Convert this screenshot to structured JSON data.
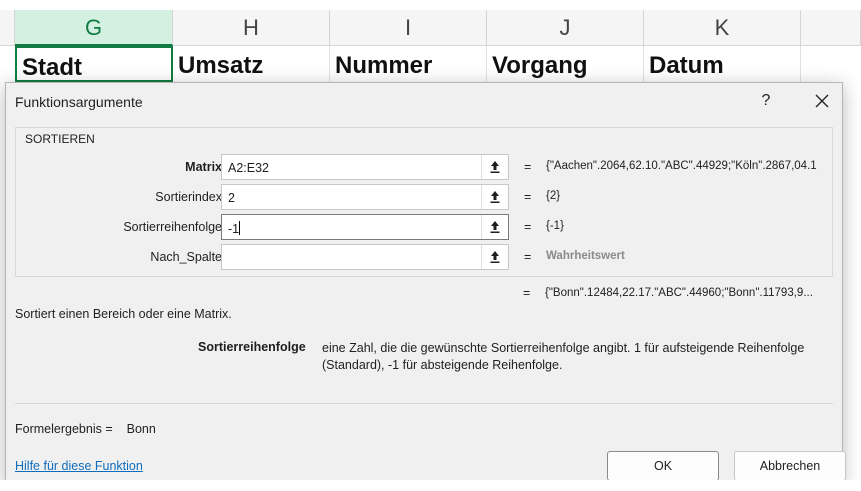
{
  "sheet": {
    "columns": [
      "G",
      "H",
      "I",
      "J",
      "K"
    ],
    "headers": [
      "Stadt",
      "Umsatz",
      "Nummer",
      "Vorgang",
      "Datum"
    ]
  },
  "dialog": {
    "title": "Funktionsargumente",
    "help_glyph": "?",
    "function_name": "SORTIEREN",
    "arguments": [
      {
        "label": "Matrix",
        "value": "A2:E32",
        "eq": "=",
        "result": "{\"Aachen\".2064,62.10.\"ABC\".44929;\"Köln\".2867,04.1"
      },
      {
        "label": "Sortierindex",
        "value": "2",
        "eq": "=",
        "result": "{2}"
      },
      {
        "label": "Sortierreihenfolge",
        "value": "-1",
        "eq": "=",
        "result": "{-1}"
      },
      {
        "label": "Nach_Spalte",
        "value": "",
        "eq": "=",
        "result": "Wahrheitswert"
      }
    ],
    "result_eq": "=",
    "result_preview": "{\"Bonn\".12484,22.17.\"ABC\".44960;\"Bonn\".11793,9...",
    "description": "Sortiert einen Bereich oder eine Matrix.",
    "param_name": "Sortierreihenfolge",
    "param_description": "eine Zahl, die die gewünschte Sortierreihenfolge angibt. 1 für aufsteigende Reihenfolge (Standard), -1 für absteigende Reihenfolge.",
    "formula_label": "Formelergebnis =",
    "formula_value": "Bonn",
    "help_link": "Hilfe für diese Funktion",
    "ok_label": "OK",
    "cancel_label": "Abbrechen"
  }
}
